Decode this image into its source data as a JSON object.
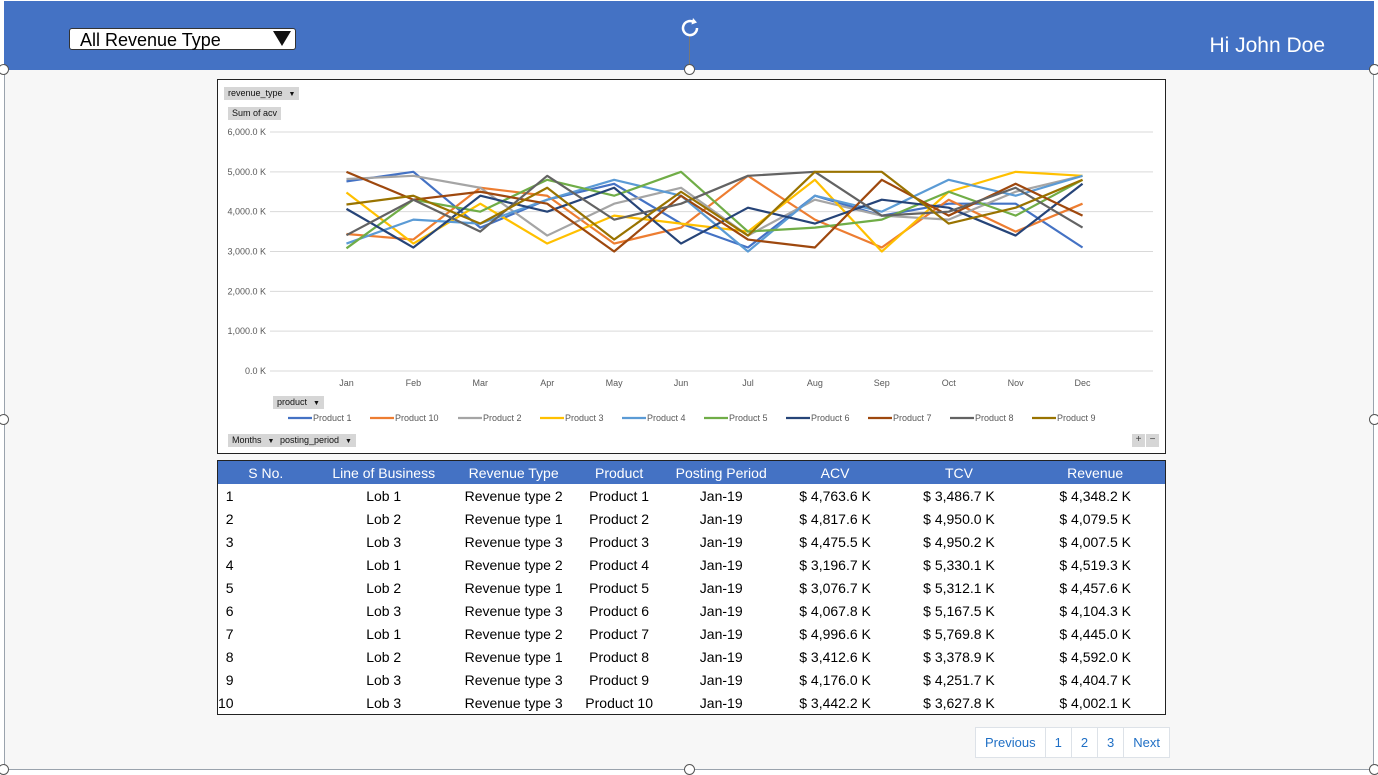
{
  "header": {
    "revenue_filter": "All Revenue Type",
    "greeting": "Hi John Doe",
    "bg_color": "#4472c4"
  },
  "chart": {
    "chips": {
      "filter_field": "revenue_type",
      "value_field": "Sum of acv",
      "legend_field": "product",
      "axis_field_1": "Months",
      "axis_field_2": "posting_period"
    },
    "controls": {
      "plus": "+",
      "minus": "−"
    }
  },
  "chart_data": {
    "type": "line",
    "title": "",
    "xlabel": "",
    "ylabel": "",
    "ylim": [
      0,
      6000
    ],
    "y_ticks": [
      "0.0 K",
      "1,000.0 K",
      "2,000.0 K",
      "3,000.0 K",
      "4,000.0 K",
      "5,000.0 K",
      "6,000.0 K"
    ],
    "grid": true,
    "legend_position": "bottom",
    "categories": [
      "Jan",
      "Feb",
      "Mar",
      "Apr",
      "May",
      "Jun",
      "Jul",
      "Aug",
      "Sep",
      "Oct",
      "Nov",
      "Dec"
    ],
    "series": [
      {
        "name": "Product 1",
        "color": "#4472c4",
        "values": [
          4760,
          5000,
          3600,
          4300,
          4700,
          3700,
          3100,
          4400,
          3900,
          4200,
          4200,
          3100
        ]
      },
      {
        "name": "Product 10",
        "color": "#ed7d31",
        "values": [
          3440,
          3300,
          4600,
          4400,
          3200,
          3600,
          4900,
          3800,
          3100,
          4300,
          3500,
          4200
        ]
      },
      {
        "name": "Product 2",
        "color": "#a5a5a5",
        "values": [
          4820,
          4900,
          4600,
          3400,
          4200,
          4600,
          3400,
          4300,
          3900,
          3800,
          4500,
          4900
        ]
      },
      {
        "name": "Product 3",
        "color": "#ffc000",
        "values": [
          4480,
          3200,
          4200,
          3200,
          3900,
          3700,
          3500,
          4800,
          3000,
          4500,
          5000,
          4900
        ]
      },
      {
        "name": "Product 4",
        "color": "#5b9bd5",
        "values": [
          3200,
          3800,
          3700,
          4300,
          4800,
          4400,
          3000,
          4400,
          4000,
          4800,
          4400,
          4900
        ]
      },
      {
        "name": "Product 5",
        "color": "#70ad47",
        "values": [
          3080,
          4300,
          4000,
          4800,
          4400,
          5000,
          3500,
          3600,
          3800,
          4500,
          3900,
          4800
        ]
      },
      {
        "name": "Product 6",
        "color": "#264478",
        "values": [
          4070,
          3100,
          4400,
          4000,
          4600,
          3200,
          4100,
          3700,
          4300,
          4100,
          3400,
          4700
        ]
      },
      {
        "name": "Product 7",
        "color": "#9e480e",
        "values": [
          5000,
          4300,
          4500,
          4200,
          3000,
          4400,
          3300,
          3100,
          4800,
          3900,
          4700,
          3900
        ]
      },
      {
        "name": "Product 8",
        "color": "#636363",
        "values": [
          3410,
          4300,
          3500,
          4900,
          3800,
          4200,
          4900,
          5000,
          3900,
          4000,
          4600,
          3600
        ]
      },
      {
        "name": "Product 9",
        "color": "#997300",
        "values": [
          4180,
          4400,
          3700,
          4600,
          3300,
          4500,
          3400,
          5000,
          5000,
          3700,
          4100,
          4800
        ]
      }
    ]
  },
  "table": {
    "headers": [
      "S No.",
      "Line of Business",
      "Revenue Type",
      "Product",
      "Posting Period",
      "ACV",
      "TCV",
      "Revenue"
    ],
    "rows": [
      [
        "1",
        "Lob 1",
        "Revenue type 2",
        "Product 1",
        "Jan-19",
        "$ 4,763.6 K",
        "$ 3,486.7 K",
        "$ 4,348.2 K"
      ],
      [
        "2",
        "Lob 2",
        "Revenue type 1",
        "Product 2",
        "Jan-19",
        "$ 4,817.6 K",
        "$ 4,950.0 K",
        "$ 4,079.5 K"
      ],
      [
        "3",
        "Lob 3",
        "Revenue type 3",
        "Product 3",
        "Jan-19",
        "$ 4,475.5 K",
        "$ 4,950.2 K",
        "$ 4,007.5 K"
      ],
      [
        "4",
        "Lob 1",
        "Revenue type 2",
        "Product 4",
        "Jan-19",
        "$ 3,196.7 K",
        "$ 5,330.1 K",
        "$ 4,519.3 K"
      ],
      [
        "5",
        "Lob 2",
        "Revenue type 1",
        "Product 5",
        "Jan-19",
        "$ 3,076.7 K",
        "$ 5,312.1 K",
        "$ 4,457.6 K"
      ],
      [
        "6",
        "Lob 3",
        "Revenue type 3",
        "Product 6",
        "Jan-19",
        "$ 4,067.8 K",
        "$ 5,167.5 K",
        "$ 4,104.3 K"
      ],
      [
        "7",
        "Lob 1",
        "Revenue type 2",
        "Product 7",
        "Jan-19",
        "$ 4,996.6 K",
        "$ 5,769.8 K",
        "$ 4,445.0 K"
      ],
      [
        "8",
        "Lob 2",
        "Revenue type 1",
        "Product 8",
        "Jan-19",
        "$ 3,412.6 K",
        "$ 3,378.9 K",
        "$ 4,592.0 K"
      ],
      [
        "9",
        "Lob 3",
        "Revenue type 3",
        "Product 9",
        "Jan-19",
        "$ 4,176.0 K",
        "$ 4,251.7 K",
        "$ 4,404.7 K"
      ],
      [
        "10",
        "Lob 3",
        "Revenue type 3",
        "Product 10",
        "Jan-19",
        "$ 3,442.2 K",
        "$ 3,627.8 K",
        "$ 4,002.1 K"
      ]
    ]
  },
  "pagination": {
    "previous": "Previous",
    "pages": [
      "1",
      "2",
      "3"
    ],
    "next": "Next"
  }
}
